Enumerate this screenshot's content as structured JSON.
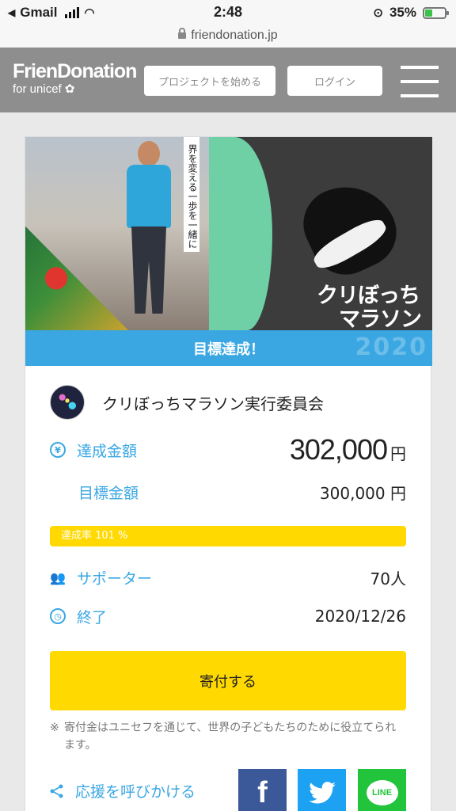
{
  "status_bar": {
    "back_app": "Gmail",
    "time": "2:48",
    "battery": "35%"
  },
  "url_bar": {
    "domain": "friendonation.jp"
  },
  "header": {
    "logo_main": "FrienDonation",
    "logo_sub": "for unicef",
    "start_project_label": "プロジェクトを始める",
    "login_label": "ログイン"
  },
  "project": {
    "hero_vertical_text": "界を変える一歩を一緒に",
    "hero_title_line1": "クリぼっち",
    "hero_title_line2": "マラソン",
    "hero_year": "2020",
    "goal_banner": "目標達成！",
    "organizer": "クリぼっちマラソン実行委員会",
    "achieved_label": "達成金額",
    "achieved_amount": "302,000",
    "yen": "円",
    "target_label": "目標金額",
    "target_amount": "300,000",
    "progress_label": "達成率 101 %",
    "progress_percent": 101,
    "supporters_label": "サポーター",
    "supporters_value": "70人",
    "end_label": "終了",
    "end_date": "2020/12/26",
    "donate_label": "寄付する",
    "note_mark": "※",
    "note_text": "寄付金はユニセフを通じて、世界の子どもたちのために役立てられます。",
    "share_label": "応援を呼びかける",
    "line_label": "LINE"
  },
  "colors": {
    "accent_blue": "#3aa7e3",
    "yellow": "#ffd900",
    "header_gray": "#8e8e8e",
    "facebook": "#3b5998",
    "twitter": "#1da1f2",
    "line": "#21c43b"
  }
}
